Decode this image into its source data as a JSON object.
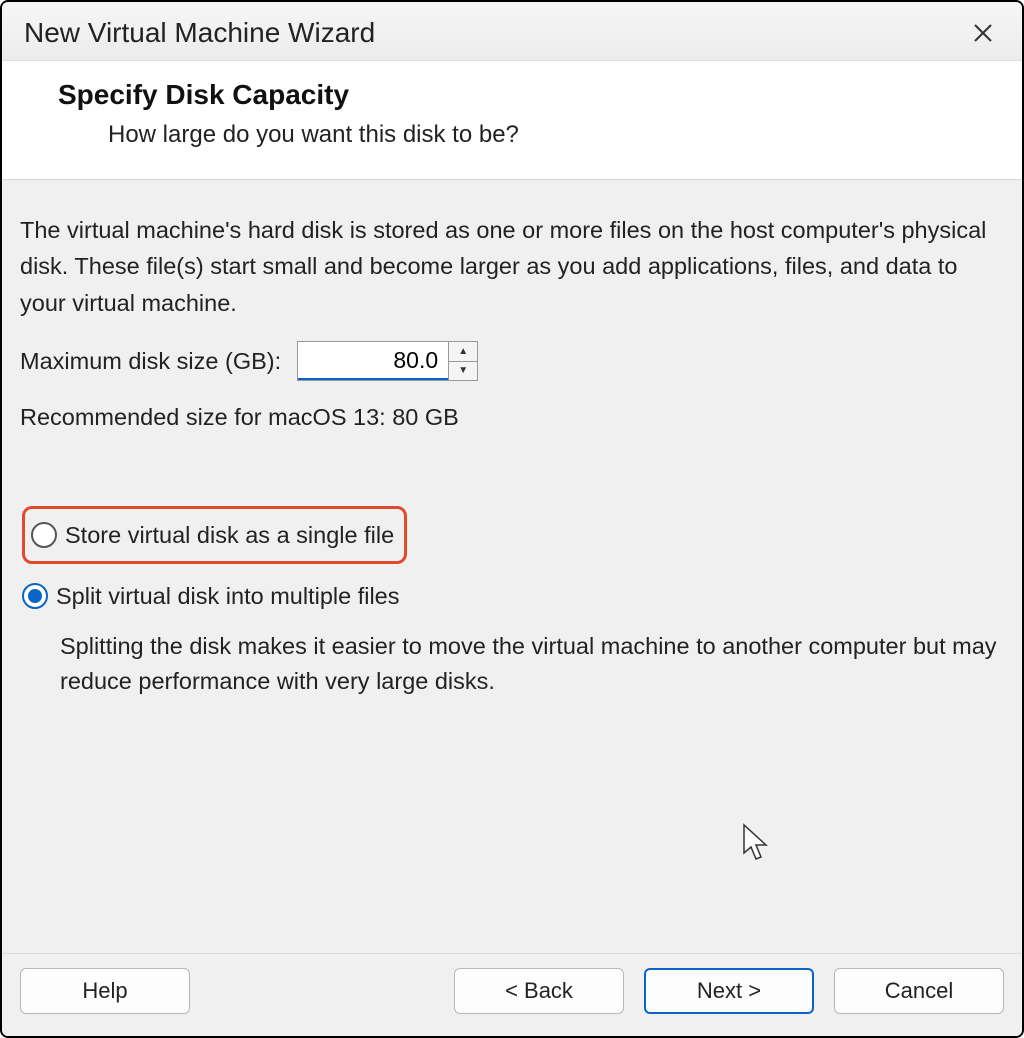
{
  "titlebar": {
    "title": "New Virtual Machine Wizard"
  },
  "header": {
    "title": "Specify Disk Capacity",
    "subtitle": "How large do you want this disk to be?"
  },
  "body": {
    "description": "The virtual machine's hard disk is stored as one or more files on the host computer's physical disk. These file(s) start small and become larger as you add applications, files, and data to your virtual machine.",
    "size_label": "Maximum disk size (GB):",
    "size_value": "80.0",
    "recommended": "Recommended size for macOS 13: 80 GB",
    "radio_single": "Store virtual disk as a single file",
    "radio_split": "Split virtual disk into multiple files",
    "split_description": "Splitting the disk makes it easier to move the virtual machine to another computer but may reduce performance with very large disks."
  },
  "footer": {
    "help": "Help",
    "back": "< Back",
    "next": "Next >",
    "cancel": "Cancel"
  }
}
